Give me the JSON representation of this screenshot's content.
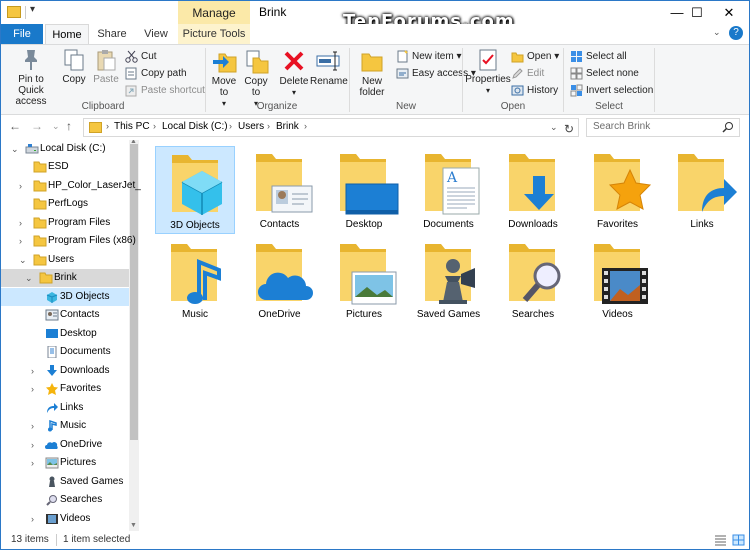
{
  "window": {
    "title": "Brink",
    "context_tab": "Manage",
    "watermark": "TenForums.com",
    "controls": {
      "minimize": "—",
      "maximize": "☐",
      "close": "✕"
    }
  },
  "ribbon_tabs": {
    "file": "File",
    "home": "Home",
    "share": "Share",
    "view": "View",
    "picture_tools": "Picture Tools",
    "help": "?"
  },
  "ribbon": {
    "clipboard": {
      "label": "Clipboard",
      "pin": "Pin to Quick access",
      "copy": "Copy",
      "paste": "Paste",
      "cut": "Cut",
      "copy_path": "Copy path",
      "paste_shortcut": "Paste shortcut"
    },
    "organize": {
      "label": "Organize",
      "move_to": "Move to",
      "copy_to": "Copy to",
      "delete": "Delete",
      "rename": "Rename"
    },
    "new": {
      "label": "New",
      "new_folder": "New folder",
      "new_item": "New item",
      "easy_access": "Easy access"
    },
    "open": {
      "label": "Open",
      "properties": "Properties",
      "open": "Open",
      "edit": "Edit",
      "history": "History"
    },
    "select": {
      "label": "Select",
      "select_all": "Select all",
      "select_none": "Select none",
      "invert": "Invert selection"
    }
  },
  "address": {
    "crumbs": [
      "This PC",
      "Local Disk (C:)",
      "Users",
      "Brink"
    ],
    "search_placeholder": "Search Brink"
  },
  "nav": [
    {
      "label": "Local Disk (C:)",
      "icon": "drive"
    },
    {
      "label": "ESD",
      "icon": "folder"
    },
    {
      "label": "HP_Color_LaserJet_l",
      "icon": "folder"
    },
    {
      "label": "PerfLogs",
      "icon": "folder"
    },
    {
      "label": "Program Files",
      "icon": "folder"
    },
    {
      "label": "Program Files (x86)",
      "icon": "folder"
    },
    {
      "label": "Users",
      "icon": "folder"
    },
    {
      "label": "Brink",
      "icon": "folder"
    },
    {
      "label": "3D Objects",
      "icon": "3d"
    },
    {
      "label": "Contacts",
      "icon": "contacts"
    },
    {
      "label": "Desktop",
      "icon": "desktop"
    },
    {
      "label": "Documents",
      "icon": "documents"
    },
    {
      "label": "Downloads",
      "icon": "downloads"
    },
    {
      "label": "Favorites",
      "icon": "favorites"
    },
    {
      "label": "Links",
      "icon": "links"
    },
    {
      "label": "Music",
      "icon": "music"
    },
    {
      "label": "OneDrive",
      "icon": "onedrive"
    },
    {
      "label": "Pictures",
      "icon": "pictures"
    },
    {
      "label": "Saved Games",
      "icon": "saved-games"
    },
    {
      "label": "Searches",
      "icon": "searches"
    },
    {
      "label": "Videos",
      "icon": "videos"
    }
  ],
  "items": [
    {
      "label": "3D Objects",
      "icon": "3d-objects-icon"
    },
    {
      "label": "Contacts",
      "icon": "contacts-icon"
    },
    {
      "label": "Desktop",
      "icon": "desktop-icon"
    },
    {
      "label": "Documents",
      "icon": "documents-icon"
    },
    {
      "label": "Downloads",
      "icon": "downloads-icon"
    },
    {
      "label": "Favorites",
      "icon": "favorites-icon"
    },
    {
      "label": "Links",
      "icon": "links-icon"
    },
    {
      "label": "Music",
      "icon": "music-icon"
    },
    {
      "label": "OneDrive",
      "icon": "onedrive-icon"
    },
    {
      "label": "Pictures",
      "icon": "pictures-icon"
    },
    {
      "label": "Saved Games",
      "icon": "saved-games-icon"
    },
    {
      "label": "Searches",
      "icon": "searches-icon"
    },
    {
      "label": "Videos",
      "icon": "videos-icon"
    }
  ],
  "status": {
    "count": "13 items",
    "selected": "1 item selected"
  },
  "colors": {
    "accent": "#1979ca",
    "folder": "#f5c640",
    "selection": "#cce8ff",
    "context_tab": "#fbe9a8"
  }
}
